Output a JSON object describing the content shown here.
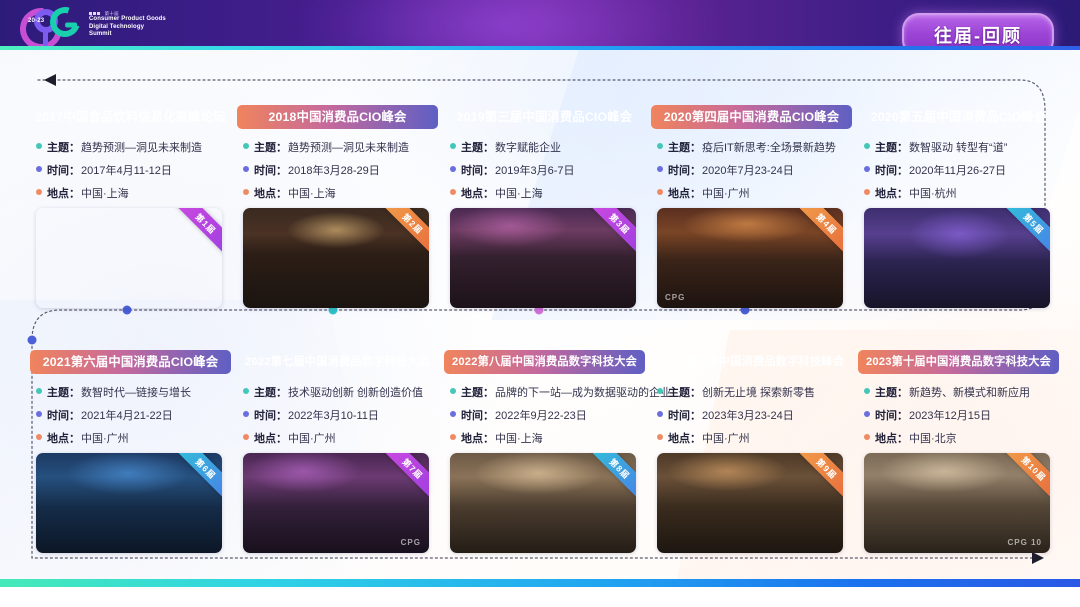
{
  "header": {
    "logo": {
      "year": "20-23",
      "cn_line": "第十届",
      "en_line1": "Consumer Product Goods",
      "en_line2": "Digital Technology",
      "en_line3": "Summit"
    },
    "title_badge": "往届-回顾"
  },
  "labels": {
    "topic": "主题：",
    "time": "时间：",
    "place": "地点："
  },
  "colors": {
    "title_green": "#1fbf8a",
    "title_orange": "#f0845c",
    "title_purple": "#5f5fc4",
    "dot_topic": "#44c7b8",
    "dot_time": "#6a6ee0",
    "dot_place": "#f08a63",
    "badge_purple": "#9b44d6",
    "accent_bar": "#21a6f0"
  },
  "cards": [
    {
      "title": "2017中国食品饮料信息化高峰论坛",
      "title_style": "t-green",
      "topic": "趋势预测—洞见未来制造",
      "time": "2017年4月11-12日",
      "place": "中国·上海",
      "ribbon": "第1届",
      "ribbon_style": "",
      "watermark": ""
    },
    {
      "title": "2018中国消费品CIO峰会",
      "title_style": "t-orange",
      "topic": "趋势预测—洞见未来制造",
      "time": "2018年3月28-29日",
      "place": "中国·上海",
      "ribbon": "第2届",
      "ribbon_style": "warm",
      "watermark": ""
    },
    {
      "title": "2019第三届中国消费品CIO峰会",
      "title_style": "t-green",
      "topic": "数字赋能企业",
      "time": "2019年3月6-7日",
      "place": "中国·上海",
      "ribbon": "第3届",
      "ribbon_style": "",
      "watermark": ""
    },
    {
      "title": "2020第四届中国消费品CIO峰会",
      "title_style": "t-orange",
      "topic": "疫后IT新思考:全场景新趋势",
      "time": "2020年7月23-24日",
      "place": "中国·广州",
      "ribbon": "第4届",
      "ribbon_style": "warm",
      "watermark": "CPG"
    },
    {
      "title": "2020第五届中国消费品CIO峰会",
      "title_style": "t-green",
      "topic": "数智驱动 转型有“道”",
      "time": "2020年11月26-27日",
      "place": "中国·杭州",
      "ribbon": "第5届",
      "ribbon_style": "cool",
      "watermark": ""
    },
    {
      "title": "2021第六届中国消费品CIO峰会",
      "title_style": "t-orange",
      "topic": "数智时代—链接与增长",
      "time": "2021年4月21-22日",
      "place": "中国·广州",
      "ribbon": "第6届",
      "ribbon_style": "cool",
      "watermark": ""
    },
    {
      "title": "2022第七届中国消费品数字科技大会",
      "title_style": "t-green",
      "topic": "技术驱动创新 创新创造价值",
      "time": "2022年3月10-11日",
      "place": "中国·广州",
      "ribbon": "第7届",
      "ribbon_style": "",
      "watermark": "CPG"
    },
    {
      "title": "2022第八届中国消费品数字科技大会",
      "title_style": "t-orange",
      "topic": "品牌的下一站—成为数据驱动的企业",
      "time": "2022年9月22-23日",
      "place": "中国·上海",
      "ribbon": "第8届",
      "ribbon_style": "cool",
      "watermark": ""
    },
    {
      "title": "2023第九届中国消费品数字科技峰会",
      "title_style": "t-green",
      "topic": "创新无止境 探索新零售",
      "time": "2023年3月23-24日",
      "place": "中国·广州",
      "ribbon": "第9届",
      "ribbon_style": "warm",
      "watermark": ""
    },
    {
      "title": "2023第十届中国消费品数字科技大会",
      "title_style": "t-orange",
      "topic": "新趋势、新模式和新应用",
      "time": "2023年12月15日",
      "place": "中国·北京",
      "ribbon": "第10届",
      "ribbon_style": "warm",
      "watermark": "CPG 10"
    }
  ]
}
